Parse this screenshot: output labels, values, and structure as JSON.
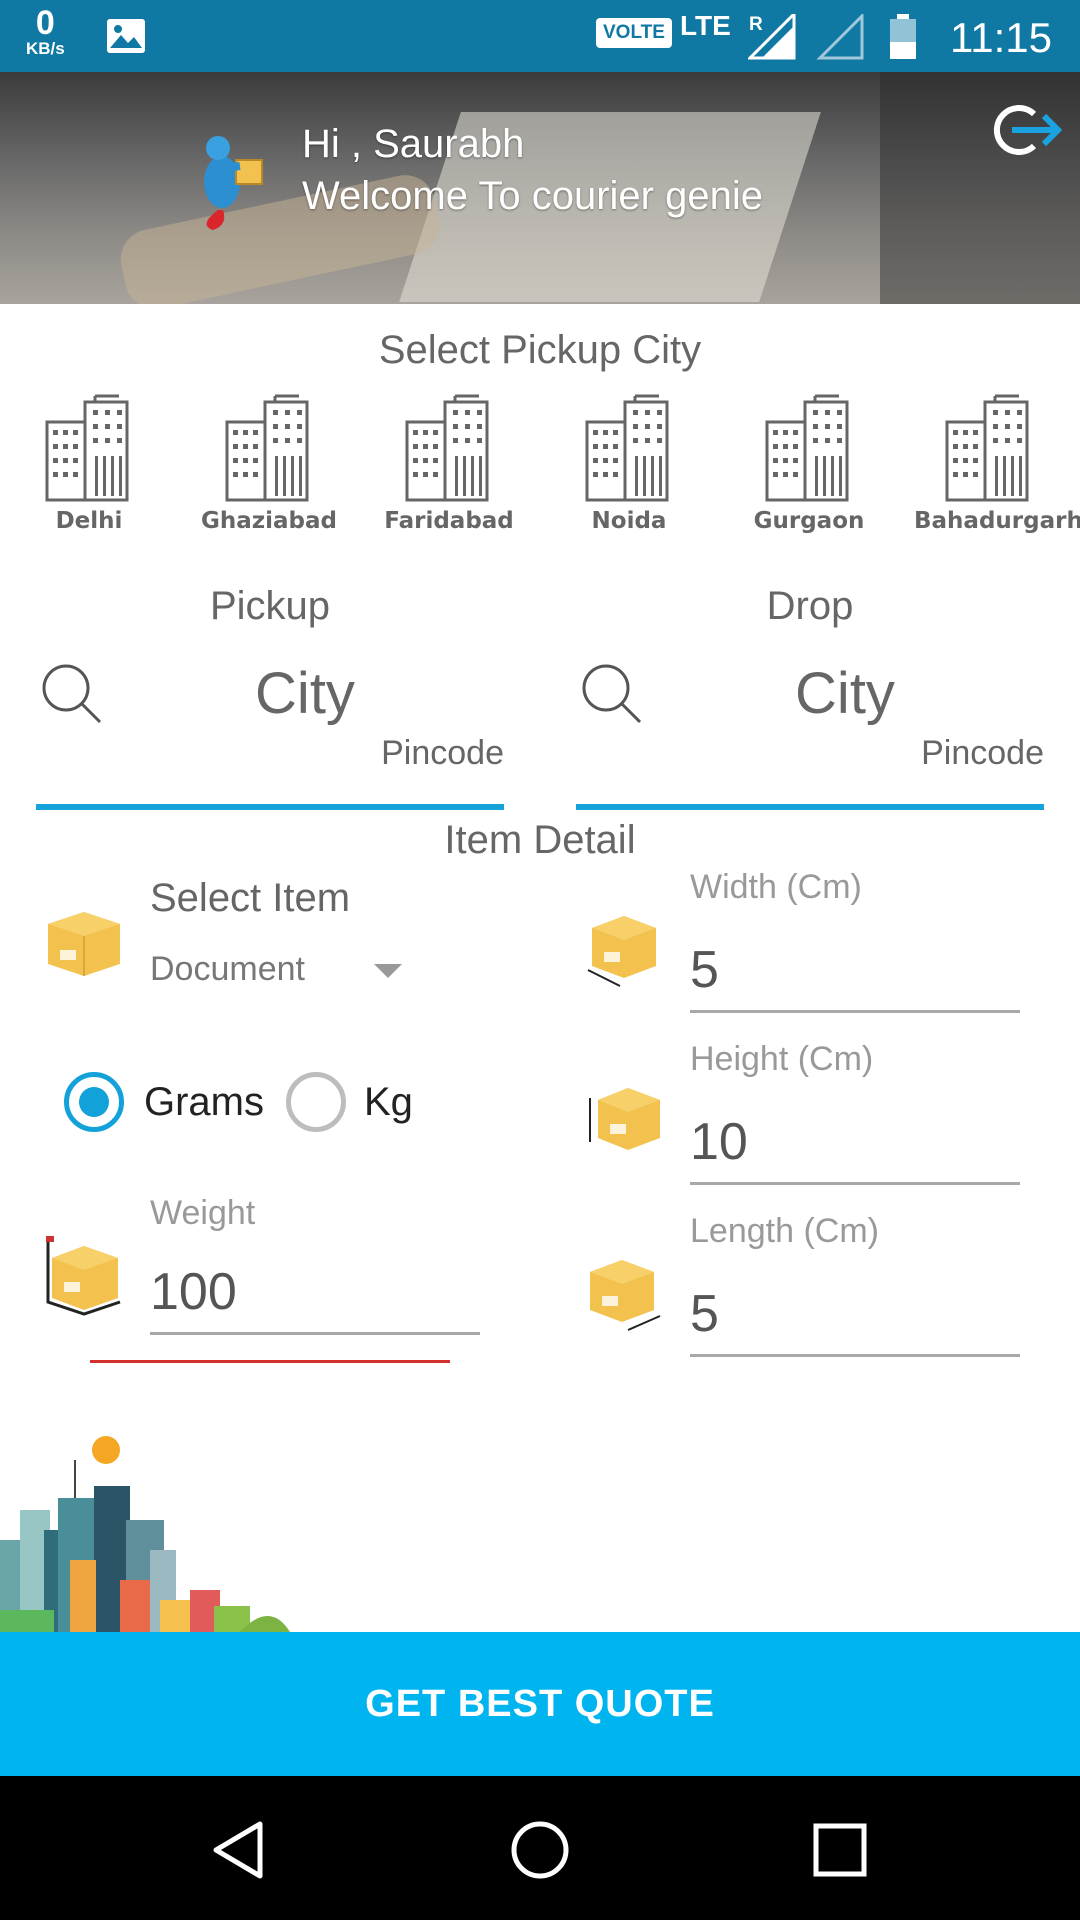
{
  "status_bar": {
    "speed_value": "0",
    "speed_unit": "KB/s",
    "volte": "VOLTE",
    "network": "LTE",
    "roaming": "R",
    "time": "11:15"
  },
  "header": {
    "greeting": "Hi , Saurabh",
    "welcome": "Welcome To courier genie"
  },
  "pickup_city": {
    "title": "Select Pickup City",
    "cities": [
      "Delhi",
      "Ghaziabad",
      "Faridabad",
      "Noida",
      "Gurgaon",
      "Bahadurgarh"
    ]
  },
  "pickup": {
    "heading": "Pickup",
    "city_placeholder": "City",
    "pincode_placeholder": "Pincode"
  },
  "drop": {
    "heading": "Drop",
    "city_placeholder": "City",
    "pincode_placeholder": "Pincode"
  },
  "item_detail": {
    "title": "Item Detail",
    "select_item_label": "Select Item",
    "selected_item": "Document",
    "units": {
      "grams_label": "Grams",
      "kg_label": "Kg",
      "selected": "Grams"
    },
    "weight_label": "Weight",
    "weight_value": "100",
    "width_label": "Width (Cm)",
    "width_value": "5",
    "height_label": "Height (Cm)",
    "height_value": "10",
    "length_label": "Length (Cm)",
    "length_value": "5"
  },
  "cta": {
    "label": "GET BEST QUOTE"
  },
  "colors": {
    "status_bar": "#0f79a4",
    "accent": "#00b5ef",
    "underline_active": "#14a2d8",
    "radio_active": "#12a2d9",
    "error_line": "#d32f2f",
    "box": "#f2c14e"
  },
  "icons": {
    "logout": "logout-icon",
    "search": "search-icon",
    "city": "building-icon",
    "box": "package-icon"
  }
}
